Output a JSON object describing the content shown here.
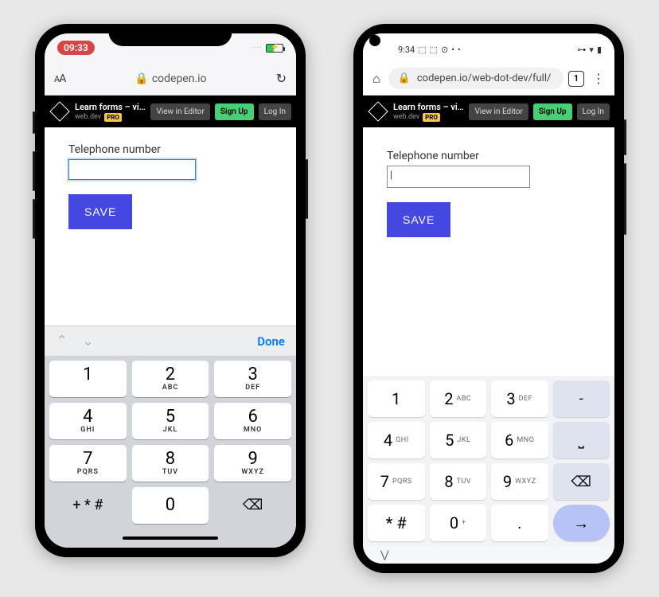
{
  "ios": {
    "status": {
      "time": "09:33"
    },
    "addr": {
      "text_label": "AA",
      "domain": "codepen.io"
    },
    "cp": {
      "title": "Learn forms – virt...",
      "author": "web.dev",
      "pro": "PRO",
      "view": "View in Editor",
      "signup": "Sign Up",
      "login": "Log In"
    },
    "form": {
      "label": "Telephone number",
      "value": "",
      "save": "SAVE"
    },
    "kbd": {
      "done": "Done",
      "keys": [
        {
          "n": "1",
          "l": ""
        },
        {
          "n": "2",
          "l": "ABC"
        },
        {
          "n": "3",
          "l": "DEF"
        },
        {
          "n": "4",
          "l": "GHI"
        },
        {
          "n": "5",
          "l": "JKL"
        },
        {
          "n": "6",
          "l": "MNO"
        },
        {
          "n": "7",
          "l": "PQRS"
        },
        {
          "n": "8",
          "l": "TUV"
        },
        {
          "n": "9",
          "l": "WXYZ"
        }
      ],
      "sym": "+ * #",
      "zero": "0",
      "del": "⌫"
    }
  },
  "android": {
    "status": {
      "time": "9:34"
    },
    "addr": {
      "url": "codepen.io/web-dot-dev/full/",
      "tabs": "1"
    },
    "cp": {
      "title": "Learn forms – virt...",
      "author": "web.dev",
      "pro": "PRO",
      "view": "View in Editor",
      "signup": "Sign Up",
      "login": "Log In"
    },
    "form": {
      "label": "Telephone number",
      "value": "",
      "save": "SAVE",
      "cursor": "|"
    },
    "kbd": {
      "keys": [
        {
          "n": "1",
          "l": ""
        },
        {
          "n": "2",
          "l": "ABC"
        },
        {
          "n": "3",
          "l": "DEF"
        },
        {
          "n": "-",
          "l": "",
          "fn": true
        },
        {
          "n": "4",
          "l": "GHI"
        },
        {
          "n": "5",
          "l": "JKL"
        },
        {
          "n": "6",
          "l": "MNO"
        },
        {
          "n": "⎵",
          "l": "",
          "fn": true
        },
        {
          "n": "7",
          "l": "PQRS"
        },
        {
          "n": "8",
          "l": "TUV"
        },
        {
          "n": "9",
          "l": "WXYZ"
        },
        {
          "n": "⌫",
          "l": "",
          "fn": true
        },
        {
          "n": "* #",
          "l": ""
        },
        {
          "n": "0",
          "l": "+"
        },
        {
          "n": ".",
          "l": ""
        },
        {
          "n": "→",
          "l": "",
          "go": true
        }
      ],
      "nav_back": "⋁"
    }
  }
}
